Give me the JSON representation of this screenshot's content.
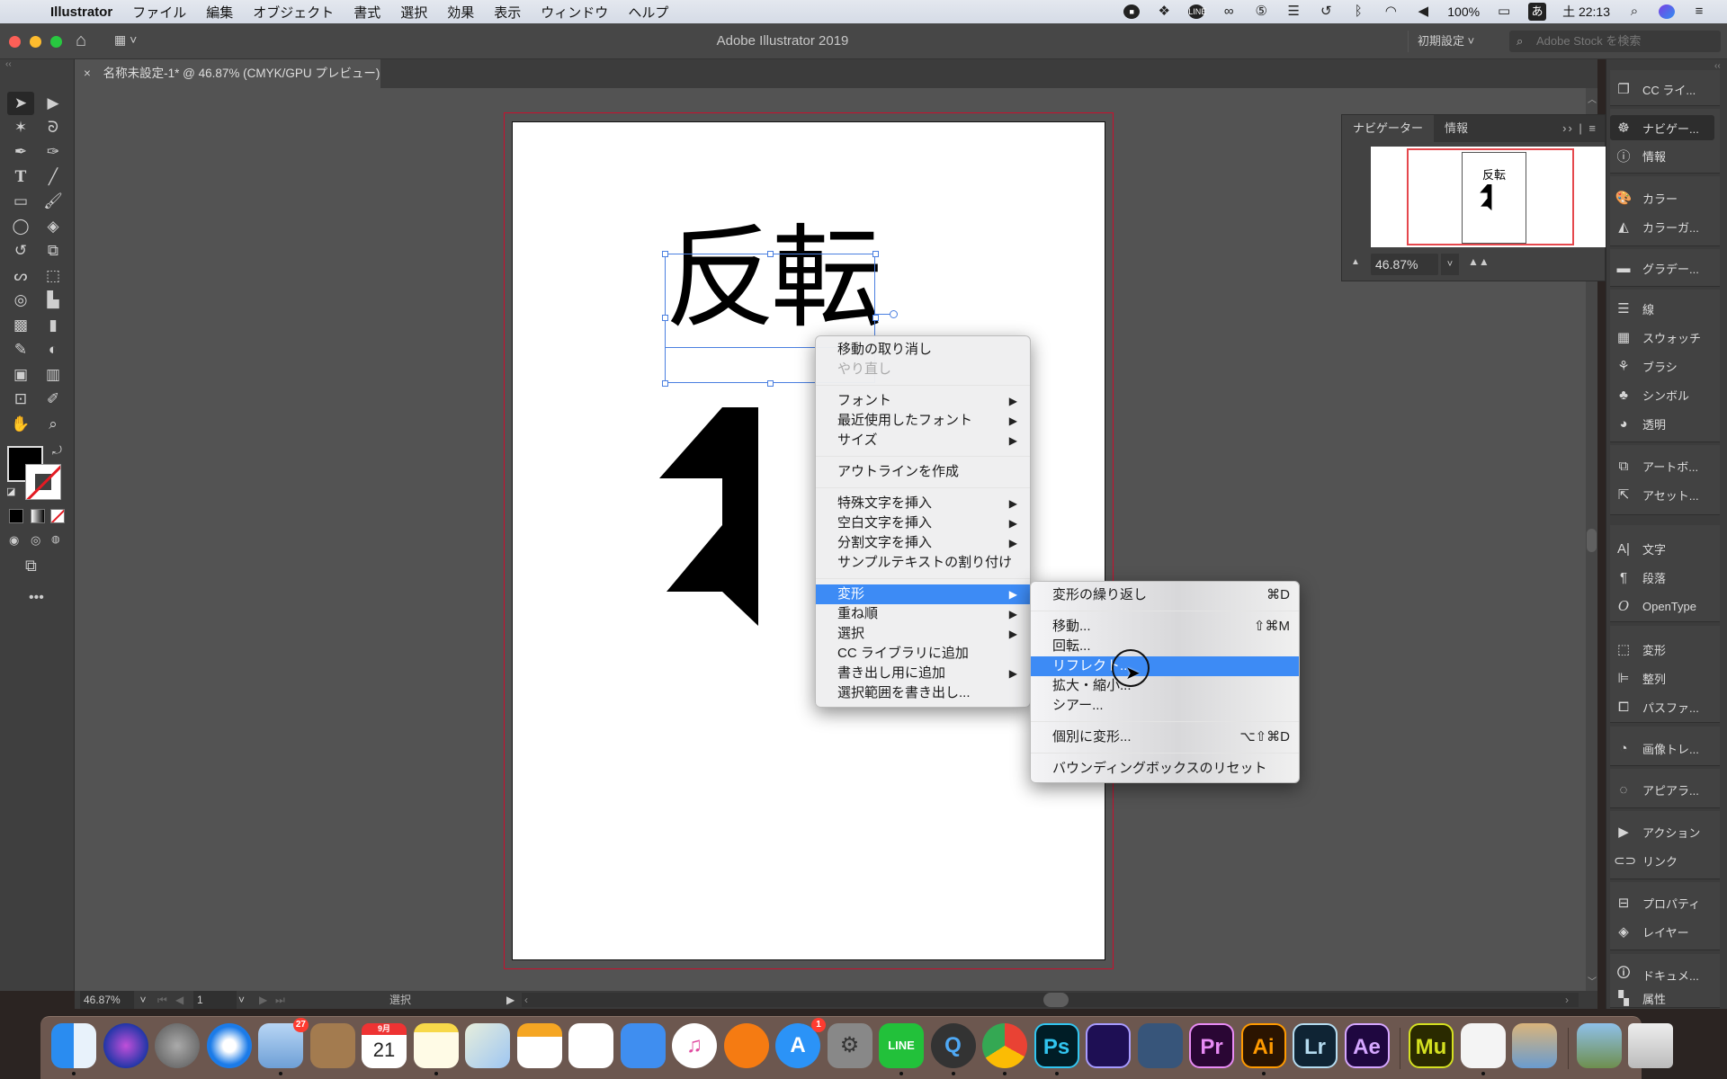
{
  "menubar": {
    "app_name": "Illustrator",
    "items": [
      "ファイル",
      "編集",
      "オブジェクト",
      "書式",
      "選択",
      "効果",
      "表示",
      "ウィンドウ",
      "ヘルプ"
    ],
    "status": {
      "battery": "100%",
      "ime": "あ",
      "clock": "土 22:13"
    },
    "status_icons": [
      "record-icon",
      "dropbox-icon",
      "line-icon",
      "creative-cloud-icon",
      "html5-icon",
      "menu-extra-icon",
      "time-machine-icon",
      "bluetooth-icon",
      "wifi-icon",
      "volume-icon",
      "battery-icon",
      "ime-icon",
      "spotlight-icon",
      "siri-icon",
      "notification-center-icon"
    ]
  },
  "titlebar": {
    "title": "Adobe Illustrator 2019",
    "workspace": "初期設定",
    "search_placeholder": "Adobe Stock を検索"
  },
  "document_tab": {
    "label": "名称未設定-1* @ 46.87% (CMYK/GPU プレビュー)",
    "close": "×"
  },
  "artwork": {
    "text": "反転"
  },
  "context_menu": {
    "groups": [
      [
        {
          "label": "移動の取り消し",
          "enabled": true
        },
        {
          "label": "やり直し",
          "enabled": false
        }
      ],
      [
        {
          "label": "フォント",
          "submenu": true
        },
        {
          "label": "最近使用したフォント",
          "submenu": true
        },
        {
          "label": "サイズ",
          "submenu": true
        }
      ],
      [
        {
          "label": "アウトラインを作成"
        }
      ],
      [
        {
          "label": "特殊文字を挿入",
          "submenu": true
        },
        {
          "label": "空白文字を挿入",
          "submenu": true
        },
        {
          "label": "分割文字を挿入",
          "submenu": true
        },
        {
          "label": "サンプルテキストの割り付け"
        }
      ],
      [
        {
          "label": "変形",
          "submenu": true,
          "highlighted": true
        },
        {
          "label": "重ね順",
          "submenu": true
        },
        {
          "label": "選択",
          "submenu": true
        },
        {
          "label": "CC ライブラリに追加"
        },
        {
          "label": "書き出し用に追加",
          "submenu": true
        },
        {
          "label": "選択範囲を書き出し..."
        }
      ]
    ]
  },
  "transform_submenu": {
    "groups": [
      [
        {
          "label": "変形の繰り返し",
          "shortcut": "⌘D"
        }
      ],
      [
        {
          "label": "移動...",
          "shortcut": "⇧⌘M"
        },
        {
          "label": "回転..."
        },
        {
          "label": "リフレクト...",
          "highlighted": true
        },
        {
          "label": "拡大・縮小..."
        },
        {
          "label": "シアー..."
        }
      ],
      [
        {
          "label": "個別に変形...",
          "shortcut": "⌥⇧⌘D"
        }
      ],
      [
        {
          "label": "バウンディングボックスのリセット"
        }
      ]
    ]
  },
  "navigator": {
    "tabs": [
      "ナビゲーター",
      "情報"
    ],
    "active_tab": "ナビゲーター",
    "preview_text": "反転",
    "zoom": "46.87%"
  },
  "right_dock": {
    "groups": [
      [
        {
          "label": "CC ライ...",
          "icon": "cc-libraries-icon"
        }
      ],
      [
        {
          "label": "ナビゲー...",
          "icon": "navigator-icon",
          "active": true
        },
        {
          "label": "情報",
          "icon": "info-icon"
        }
      ],
      [
        {
          "label": "カラー",
          "icon": "color-palette-icon"
        },
        {
          "label": "カラーガ...",
          "icon": "color-guide-icon"
        }
      ],
      [
        {
          "label": "グラデー...",
          "icon": "gradient-icon"
        }
      ],
      [
        {
          "label": "線",
          "icon": "stroke-icon"
        },
        {
          "label": "スウォッチ",
          "icon": "swatches-icon"
        },
        {
          "label": "ブラシ",
          "icon": "brushes-icon"
        },
        {
          "label": "シンボル",
          "icon": "symbols-icon"
        },
        {
          "label": "透明",
          "icon": "transparency-icon"
        }
      ],
      [
        {
          "label": "アートボ...",
          "icon": "artboards-icon"
        },
        {
          "label": "アセット...",
          "icon": "asset-export-icon"
        }
      ],
      [
        {
          "label": "文字",
          "icon": "character-icon"
        },
        {
          "label": "段落",
          "icon": "paragraph-icon"
        },
        {
          "label": "OpenType",
          "icon": "opentype-icon"
        }
      ],
      [
        {
          "label": "変形",
          "icon": "transform-icon"
        },
        {
          "label": "整列",
          "icon": "align-icon"
        },
        {
          "label": "パスファ...",
          "icon": "pathfinder-icon"
        }
      ],
      [
        {
          "label": "画像トレ...",
          "icon": "image-trace-icon"
        }
      ],
      [
        {
          "label": "アピアラ...",
          "icon": "appearance-icon"
        }
      ],
      [
        {
          "label": "アクション",
          "icon": "actions-icon"
        },
        {
          "label": "リンク",
          "icon": "links-icon"
        }
      ],
      [
        {
          "label": "プロパティ",
          "icon": "properties-icon"
        },
        {
          "label": "レイヤー",
          "icon": "layers-icon"
        }
      ],
      [
        {
          "label": "ドキュメ...",
          "icon": "document-info-icon"
        },
        {
          "label": "属性",
          "icon": "attributes-icon"
        }
      ]
    ]
  },
  "statusbar": {
    "zoom": "46.87%",
    "artboard": "1",
    "tool": "選択"
  },
  "dock": {
    "apps": [
      {
        "name": "Finder",
        "label": "",
        "running": true
      },
      {
        "name": "Siri",
        "label": ""
      },
      {
        "name": "Launchpad",
        "label": ""
      },
      {
        "name": "Safari",
        "label": ""
      },
      {
        "name": "Mail",
        "label": "",
        "badge": "27",
        "running": true
      },
      {
        "name": "Contacts",
        "label": ""
      },
      {
        "name": "Calendar",
        "label": "21",
        "sub": "9月"
      },
      {
        "name": "Notes",
        "label": "",
        "running": true
      },
      {
        "name": "Maps",
        "label": ""
      },
      {
        "name": "Pages",
        "label": ""
      },
      {
        "name": "Numbers",
        "label": ""
      },
      {
        "name": "Keynote",
        "label": ""
      },
      {
        "name": "iTunes",
        "label": "♫"
      },
      {
        "name": "iBooks",
        "label": ""
      },
      {
        "name": "App Store",
        "label": "A",
        "badge": "1"
      },
      {
        "name": "System Preferences",
        "label": "⚙"
      },
      {
        "name": "LINE",
        "label": "LINE",
        "running": true
      },
      {
        "name": "QuickTime",
        "label": "Q",
        "running": true
      },
      {
        "name": "Chrome",
        "label": "",
        "running": true
      },
      {
        "name": "Photoshop",
        "label": "Ps",
        "running": true
      },
      {
        "name": "Media Encoder",
        "label": ""
      },
      {
        "name": "Bull App",
        "label": ""
      },
      {
        "name": "Premiere Pro",
        "label": "Pr"
      },
      {
        "name": "Illustrator",
        "label": "Ai",
        "running": true
      },
      {
        "name": "Lightroom",
        "label": "Lr"
      },
      {
        "name": "After Effects",
        "label": "Ae"
      },
      {
        "name": "Muse",
        "label": "Mu"
      },
      {
        "name": "TextEdit",
        "label": "",
        "running": true
      },
      {
        "name": "Preview",
        "label": ""
      },
      {
        "name": "Photos Folder",
        "label": ""
      },
      {
        "name": "Trash",
        "label": ""
      }
    ]
  },
  "colors": {
    "accent": "#3d8bf5",
    "selection": "#4a7fe0",
    "bleed": "#c8102e",
    "canvas": "#535353"
  }
}
